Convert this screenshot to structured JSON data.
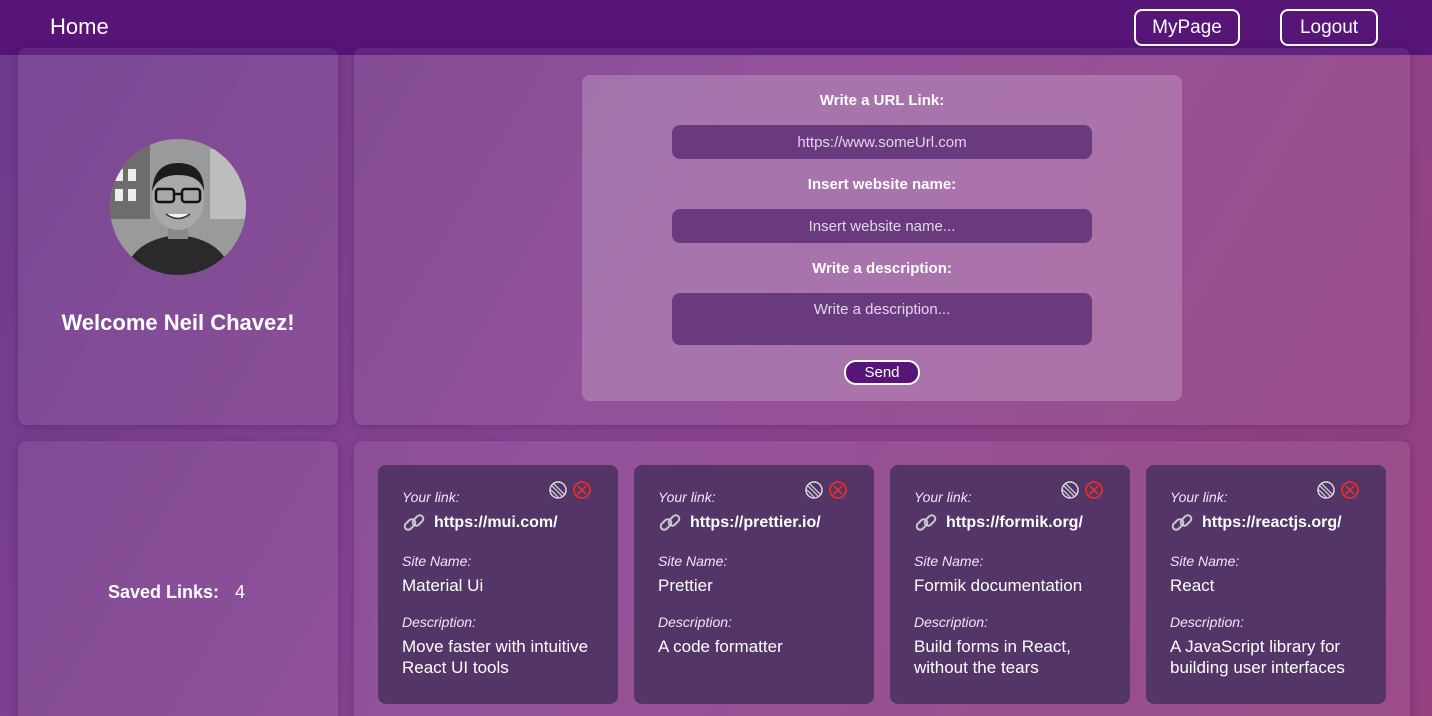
{
  "nav": {
    "home": "Home",
    "mypage": "MyPage",
    "logout": "Logout"
  },
  "profile": {
    "welcome": "Welcome Neil Chavez!"
  },
  "form": {
    "url_label": "Write a URL Link:",
    "url_placeholder": "https://www.someUrl.com",
    "name_label": "Insert website name:",
    "name_placeholder": "Insert website name...",
    "desc_label": "Write a description:",
    "desc_placeholder": "Write a description...",
    "send": "Send"
  },
  "saved": {
    "label": "Saved Links:",
    "count": "4"
  },
  "card_labels": {
    "link": "Your link:",
    "site": "Site Name:",
    "desc": "Description:"
  },
  "cards": [
    {
      "url": "https://mui.com/",
      "site": "Material Ui",
      "description": "Move faster with intuitive React UI tools"
    },
    {
      "url": "https://prettier.io/",
      "site": "Prettier",
      "description": "A code formatter"
    },
    {
      "url": "https://formik.org/",
      "site": "Formik documentation",
      "description": "Build forms in React, without the tears"
    },
    {
      "url": "https://reactjs.org/",
      "site": "React",
      "description": "A JavaScript library for building user interfaces"
    }
  ],
  "colors": {
    "navbar": "#561577",
    "card": "#533567",
    "input": "#693a7e",
    "delete": "#e03030"
  },
  "icons": {
    "edit": "edit-icon",
    "delete": "delete-icon",
    "link": "link-icon"
  }
}
